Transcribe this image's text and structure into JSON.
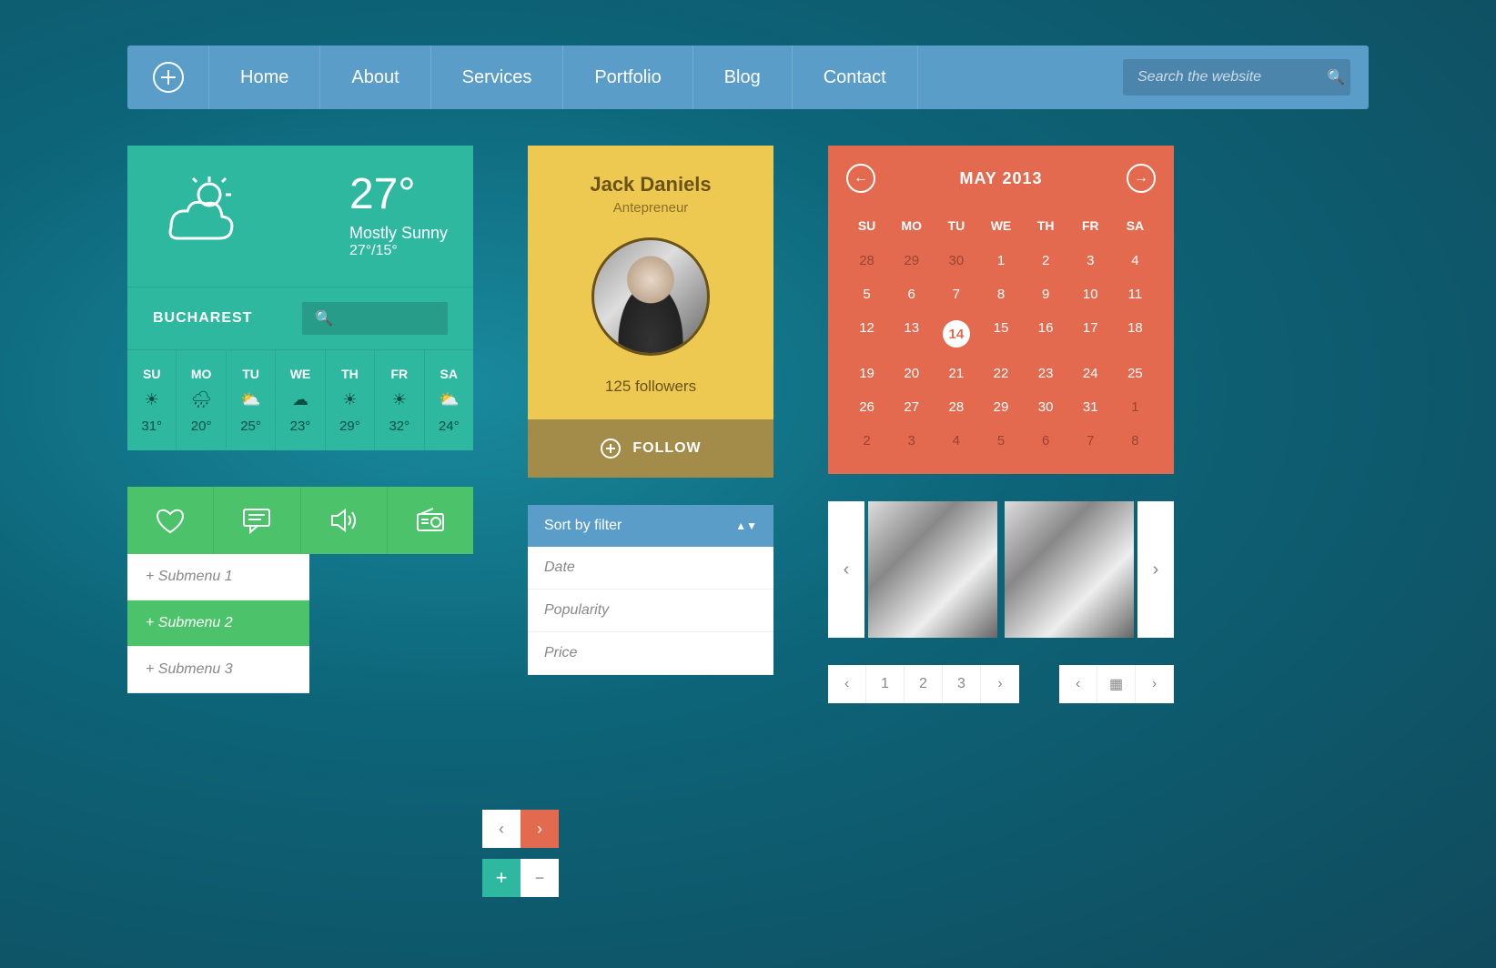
{
  "nav": {
    "items": [
      "Home",
      "About",
      "Services",
      "Portfolio",
      "Blog",
      "Contact"
    ],
    "search_placeholder": "Search the website"
  },
  "weather": {
    "temp": "27°",
    "condition": "Mostly Sunny",
    "range": "27°/15°",
    "city": "BUCHAREST",
    "days": [
      {
        "dow": "SU",
        "t": "31°"
      },
      {
        "dow": "MO",
        "t": "20°"
      },
      {
        "dow": "TU",
        "t": "25°"
      },
      {
        "dow": "WE",
        "t": "23°"
      },
      {
        "dow": "TH",
        "t": "29°"
      },
      {
        "dow": "FR",
        "t": "32°"
      },
      {
        "dow": "SA",
        "t": "24°"
      }
    ]
  },
  "profile": {
    "name": "Jack Daniels",
    "role": "Antepreneur",
    "followers": "125 followers",
    "button": "FOLLOW"
  },
  "calendar": {
    "title": "MAY 2013",
    "dow": [
      "SU",
      "MO",
      "TU",
      "WE",
      "TH",
      "FR",
      "SA"
    ],
    "cells": [
      {
        "n": "28",
        "off": true
      },
      {
        "n": "29",
        "off": true
      },
      {
        "n": "30",
        "off": true
      },
      {
        "n": "1"
      },
      {
        "n": "2"
      },
      {
        "n": "3"
      },
      {
        "n": "4"
      },
      {
        "n": "5"
      },
      {
        "n": "6"
      },
      {
        "n": "7"
      },
      {
        "n": "8"
      },
      {
        "n": "9"
      },
      {
        "n": "10"
      },
      {
        "n": "11"
      },
      {
        "n": "12"
      },
      {
        "n": "13"
      },
      {
        "n": "14",
        "sel": true
      },
      {
        "n": "15"
      },
      {
        "n": "16"
      },
      {
        "n": "17"
      },
      {
        "n": "18"
      },
      {
        "n": "19"
      },
      {
        "n": "20"
      },
      {
        "n": "21"
      },
      {
        "n": "22"
      },
      {
        "n": "23"
      },
      {
        "n": "24"
      },
      {
        "n": "25"
      },
      {
        "n": "26"
      },
      {
        "n": "27"
      },
      {
        "n": "28"
      },
      {
        "n": "29"
      },
      {
        "n": "30"
      },
      {
        "n": "31"
      },
      {
        "n": "1",
        "off": true
      },
      {
        "n": "2",
        "off": true
      },
      {
        "n": "3",
        "off": true
      },
      {
        "n": "4",
        "off": true
      },
      {
        "n": "5",
        "off": true
      },
      {
        "n": "6",
        "off": true
      },
      {
        "n": "7",
        "off": true
      },
      {
        "n": "8",
        "off": true
      }
    ]
  },
  "submenu": {
    "items": [
      "Submenu 1",
      "Submenu 2",
      "Submenu 3"
    ],
    "active": 1
  },
  "sort": {
    "label": "Sort by filter",
    "options": [
      "Date",
      "Popularity",
      "Price"
    ]
  },
  "pagination": {
    "pages": [
      "1",
      "2",
      "3"
    ]
  },
  "icons": {
    "search": "🔍",
    "prev": "‹",
    "next": "›",
    "plus": "+",
    "minus": "−",
    "grid": "▦"
  }
}
